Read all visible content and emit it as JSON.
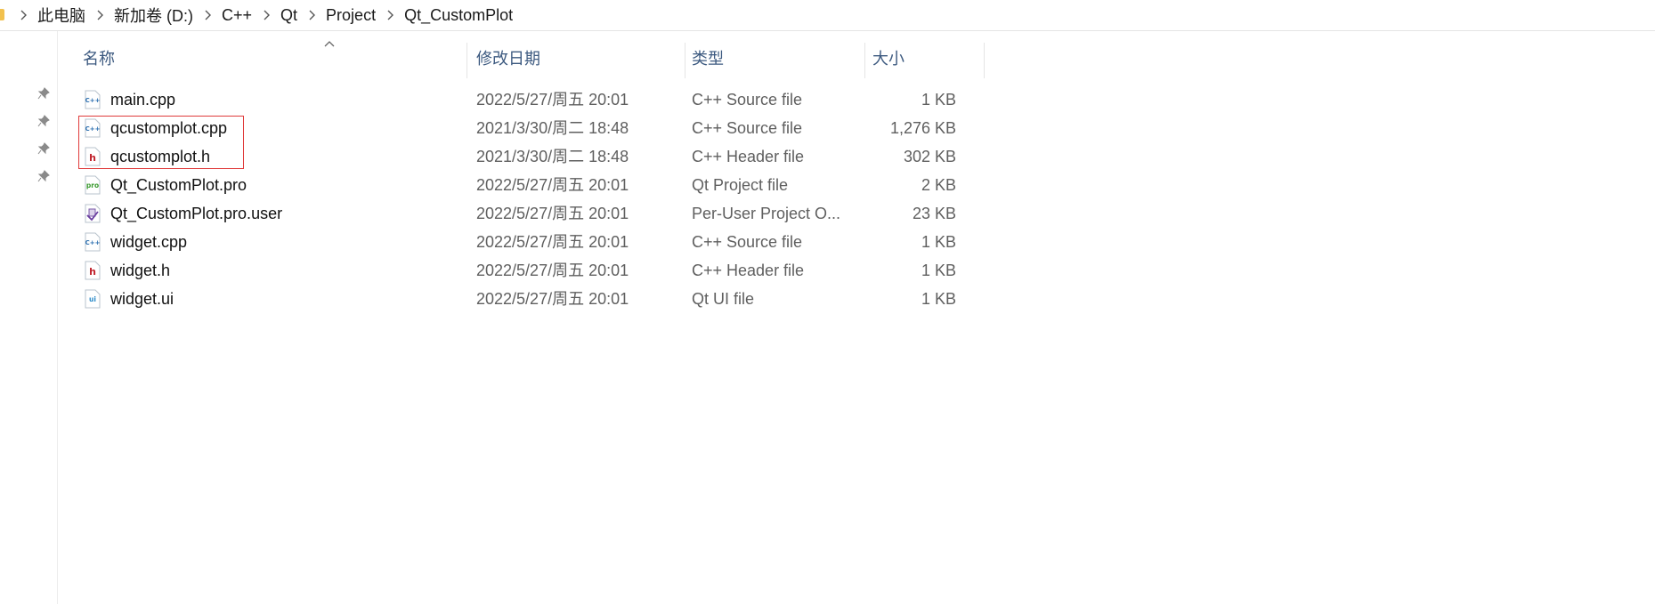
{
  "breadcrumb": {
    "items": [
      "此电脑",
      "新加卷 (D:)",
      "C++",
      "Qt",
      "Project",
      "Qt_CustomPlot"
    ]
  },
  "columns": {
    "name": "名称",
    "date": "修改日期",
    "type": "类型",
    "size": "大小"
  },
  "files": [
    {
      "name": "main.cpp",
      "date": "2022/5/27/周五 20:01",
      "type": "C++ Source file",
      "size": "1 KB",
      "icon": "cpp-file-icon"
    },
    {
      "name": "qcustomplot.cpp",
      "date": "2021/3/30/周二 18:48",
      "type": "C++ Source file",
      "size": "1,276 KB",
      "icon": "cpp-file-icon"
    },
    {
      "name": "qcustomplot.h",
      "date": "2021/3/30/周二 18:48",
      "type": "C++ Header file",
      "size": "302 KB",
      "icon": "header-file-icon"
    },
    {
      "name": "Qt_CustomPlot.pro",
      "date": "2022/5/27/周五 20:01",
      "type": "Qt Project file",
      "size": "2 KB",
      "icon": "pro-file-icon"
    },
    {
      "name": "Qt_CustomPlot.pro.user",
      "date": "2022/5/27/周五 20:01",
      "type": "Per-User Project O...",
      "size": "23 KB",
      "icon": "user-file-icon"
    },
    {
      "name": "widget.cpp",
      "date": "2022/5/27/周五 20:01",
      "type": "C++ Source file",
      "size": "1 KB",
      "icon": "cpp-file-icon"
    },
    {
      "name": "widget.h",
      "date": "2022/5/27/周五 20:01",
      "type": "C++ Header file",
      "size": "1 KB",
      "icon": "header-file-icon"
    },
    {
      "name": "widget.ui",
      "date": "2022/5/27/周五 20:01",
      "type": "Qt UI file",
      "size": "1 KB",
      "icon": "ui-file-icon"
    }
  ],
  "colors": {
    "highlight_border": "#e03a3a",
    "header_text": "#3d5a80",
    "folder": "#f2c14e"
  }
}
